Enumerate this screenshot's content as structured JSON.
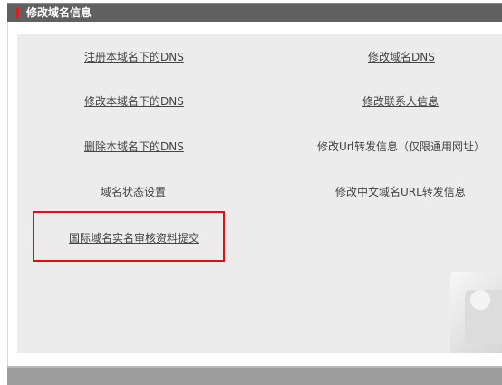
{
  "header": {
    "title": "修改域名信息"
  },
  "links": {
    "register_dns": "注册本域名下的DNS",
    "modify_domain_dns": "修改域名DNS",
    "modify_local_dns": "修改本域名下的DNS",
    "modify_contact": "修改联系人信息",
    "delete_local_dns": "删除本域名下的DNS",
    "modify_url_forward": "修改Url转发信息（仅限通用网址）",
    "domain_status": "域名状态设置",
    "modify_cn_url_forward": "修改中文域名URL转发信息",
    "intl_realname_submit": "国际域名实名审核资料提交"
  },
  "colors": {
    "header_bg": "#606060",
    "accent_red": "#d91f1f",
    "panel_bg": "#ececec",
    "highlight_border": "#e01010"
  }
}
